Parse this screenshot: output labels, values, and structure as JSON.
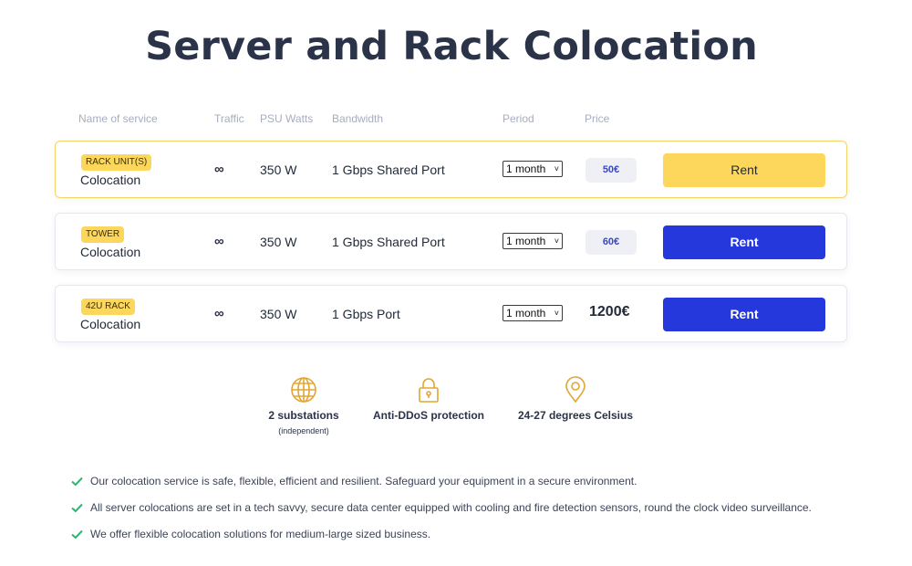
{
  "title": "Server and Rack Colocation",
  "columns": {
    "name": "Name of service",
    "traffic": "Traffic",
    "psu": "PSU Watts",
    "bandwidth": "Bandwidth",
    "period": "Period",
    "price": "Price"
  },
  "rows": [
    {
      "badge": "RACK UNIT(S)",
      "name": "Colocation",
      "traffic": "∞",
      "watts": "350 W",
      "bandwidth": "1 Gbps Shared Port",
      "period": "1 month",
      "price": "50€",
      "button": "Rent"
    },
    {
      "badge": "TOWER",
      "name": "Colocation",
      "traffic": "∞",
      "watts": "350 W",
      "bandwidth": "1 Gbps Shared Port",
      "period": "1 month",
      "price": "60€",
      "button": "Rent"
    },
    {
      "badge": "42U RACK",
      "name": "Colocation",
      "traffic": "∞",
      "watts": "350 W",
      "bandwidth": "1 Gbps Port",
      "period": "1 month",
      "price": "1200€",
      "button": "Rent"
    }
  ],
  "features": [
    {
      "icon": "globe-icon",
      "label": "2 substations",
      "sub": "(independent)"
    },
    {
      "icon": "lock-icon",
      "label": "Anti-DDoS protection"
    },
    {
      "icon": "location-pin-icon",
      "label": "24-27 degrees Celsius"
    }
  ],
  "checks": [
    "Our colocation service is safe, flexible, efficient and resilient. Safeguard your equipment in a secure environment.",
    "All server colocations are set in a tech savvy, secure data center equipped with cooling and fire detection sensors, round the clock video surveillance.",
    "We offer flexible colocation solutions for medium-large sized business."
  ],
  "colors": {
    "accent_yellow": "#fcd75c",
    "accent_blue": "#2438dc",
    "icon_gold": "#e3a531",
    "check_green": "#2bb673",
    "title": "#2a3347"
  }
}
